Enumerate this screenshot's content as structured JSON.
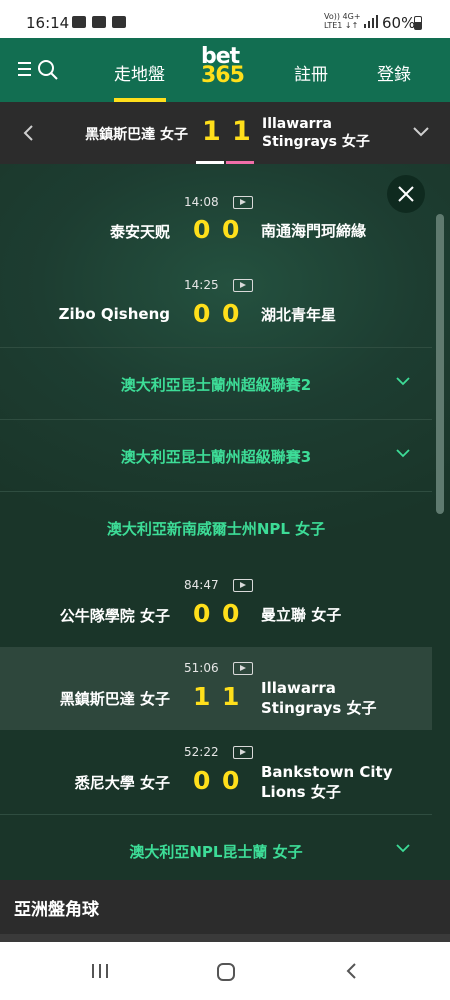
{
  "status_bar": {
    "time": "16:14",
    "network_top": "Vo)) 4G+",
    "network_bottom": "LTE1 ↓↑",
    "battery": "60%"
  },
  "nav": {
    "menu_icon": "menu-icon",
    "search_icon": "search-icon",
    "in_play": "走地盤",
    "logo_top": "bet",
    "logo_bottom": "365",
    "register": "註冊",
    "login": "登錄"
  },
  "current_match": {
    "home": "黑鎮斯巴達 女子",
    "home_score": "1",
    "away_score": "1",
    "away": "Illawarra Stingrays 女子"
  },
  "matches_top": [
    {
      "time": "14:08",
      "home": "泰安天贶",
      "home_score": "0",
      "away_score": "0",
      "away": "南通海門珂締緣"
    },
    {
      "time": "14:25",
      "home": "Zibo Qisheng",
      "home_score": "0",
      "away_score": "0",
      "away": "湖北青年星"
    }
  ],
  "leagues": {
    "l1": "澳大利亞昆士蘭州超級聯賽2",
    "l2": "澳大利亞昆士蘭州超級聯賽3",
    "l3": "澳大利亞新南威爾士州NPL 女子",
    "l4": "澳大利亞NPL昆士蘭 女子"
  },
  "matches_nsw": [
    {
      "time": "84:47",
      "home": "公牛隊學院 女子",
      "home_score": "0",
      "away_score": "0",
      "away": "曼立聯 女子"
    },
    {
      "time": "51:06",
      "home": "黑鎮斯巴達 女子",
      "home_score": "1",
      "away_score": "1",
      "away": "Illawarra Stingrays 女子"
    },
    {
      "time": "52:22",
      "home": "悉尼大學 女子",
      "home_score": "0",
      "away_score": "0",
      "away": "Bankstown City Lions 女子"
    }
  ],
  "bottom": {
    "title": "亞洲盤角球"
  },
  "colors": {
    "brand_green": "#126e51",
    "accent_yellow": "#ffdf1b",
    "league_green": "#3ddc97"
  }
}
